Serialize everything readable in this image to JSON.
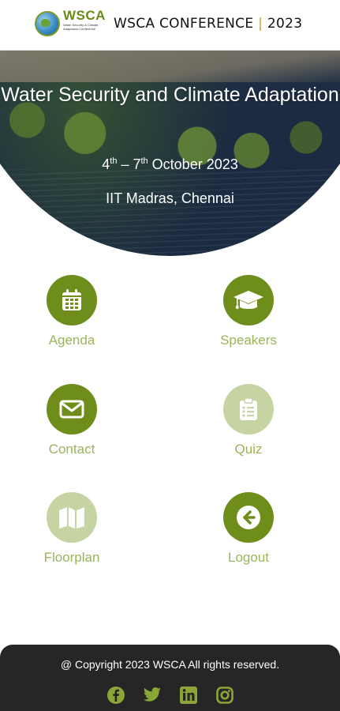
{
  "header": {
    "logo_text": "WSCA",
    "logo_subtitle": "Water Security & Climate Adaptation Conference",
    "title_left": "WSCA CONFERENCE",
    "separator": "|",
    "title_right": "2023"
  },
  "hero": {
    "title": "Water Security and Climate Adaptation",
    "date_start_day": "4",
    "date_start_suffix": "th",
    "date_dash": " – ",
    "date_end_day": "7",
    "date_end_suffix": "th",
    "date_rest": " October 2023",
    "venue": "IIT Madras, Chennai"
  },
  "menu": {
    "agenda": {
      "label": "Agenda",
      "icon": "calendar-icon",
      "active": true
    },
    "speakers": {
      "label": "Speakers",
      "icon": "graduation-cap-icon",
      "active": true
    },
    "contact": {
      "label": "Contact",
      "icon": "envelope-icon",
      "active": true
    },
    "quiz": {
      "label": "Quiz",
      "icon": "clipboard-list-icon",
      "active": false
    },
    "floorplan": {
      "label": "Floorplan",
      "icon": "map-icon",
      "active": false
    },
    "logout": {
      "label": "Logout",
      "icon": "arrow-left-circle-icon",
      "active": true
    }
  },
  "footer": {
    "copyright": "@ Copyright 2023 WSCA All rights reserved.",
    "socials": [
      "facebook-icon",
      "twitter-icon",
      "linkedin-icon",
      "instagram-icon"
    ]
  },
  "colors": {
    "accent_dark": "#6e8d1a",
    "accent_light": "#c6d3a2",
    "label": "#9bb45a",
    "footer_bg": "#262626"
  }
}
